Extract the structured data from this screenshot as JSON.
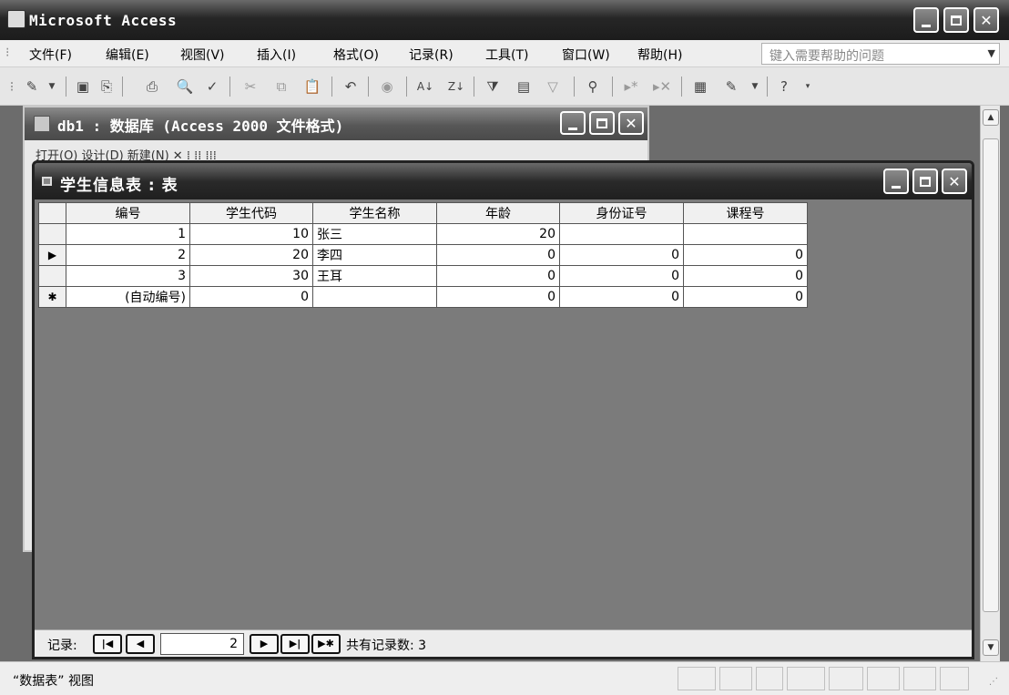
{
  "app": {
    "title": "Microsoft Access"
  },
  "menu": {
    "items": [
      "文件(F)",
      "编辑(E)",
      "视图(V)",
      "插入(I)",
      "格式(O)",
      "记录(R)",
      "工具(T)",
      "窗口(W)",
      "帮助(H)"
    ],
    "help_placeholder": "键入需要帮助的问题"
  },
  "db_window": {
    "title": "db1 : 数据库 (Access 2000 文件格式)",
    "toolbar_text": "打开(O)  设计(D)  新建(N)  ✕  ⁞  ⁞⁞  ⁞⁞⁞"
  },
  "table_window": {
    "title": "学生信息表 : 表",
    "columns": [
      "编号",
      "学生代码",
      "学生名称",
      "年龄",
      "身份证号",
      "课程号"
    ],
    "rows": [
      {
        "selector": "",
        "cells": [
          "1",
          "10",
          "张三",
          "20",
          "",
          ""
        ]
      },
      {
        "selector": "▶",
        "cells": [
          "2",
          "20",
          "李四",
          "0",
          "0",
          "0"
        ]
      },
      {
        "selector": "",
        "cells": [
          "3",
          "30",
          "王耳",
          "0",
          "0",
          "0"
        ]
      },
      {
        "selector": "✱",
        "cells": [
          "(自动编号)",
          "0",
          "",
          "0",
          "0",
          "0"
        ]
      }
    ],
    "nav": {
      "label": "记录:",
      "current": "2",
      "total_label": "共有记录数: 3"
    }
  },
  "status": {
    "text": "“数据表” 视图"
  },
  "colors": {
    "title_dark": "#1f1f1f",
    "mdi_bg": "#6c6c6c",
    "grid_bg": "#7b7b7b"
  }
}
